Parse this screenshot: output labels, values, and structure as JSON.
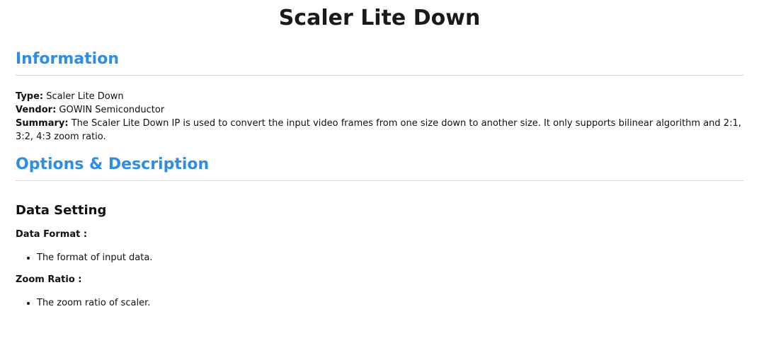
{
  "title": "Scaler Lite Down",
  "information": {
    "heading": "Information",
    "type_label": "Type:",
    "type_value": "Scaler Lite Down",
    "vendor_label": "Vendor:",
    "vendor_value": "GOWIN Semiconductor",
    "summary_label": "Summary:",
    "summary_value": "The Scaler Lite Down IP is used to convert the input video frames from one size down to another size. It only supports bilinear algorithm and 2:1, 3:2, 4:3 zoom ratio."
  },
  "options": {
    "heading": "Options & Description",
    "data_setting": {
      "heading": "Data Setting",
      "items": [
        {
          "label": "Data Format :",
          "description": "The format of input data."
        },
        {
          "label": "Zoom Ratio :",
          "description": "The zoom ratio of scaler."
        }
      ]
    }
  },
  "colors": {
    "section_heading": "#2f8de4",
    "rule": "#d9d9d9"
  }
}
